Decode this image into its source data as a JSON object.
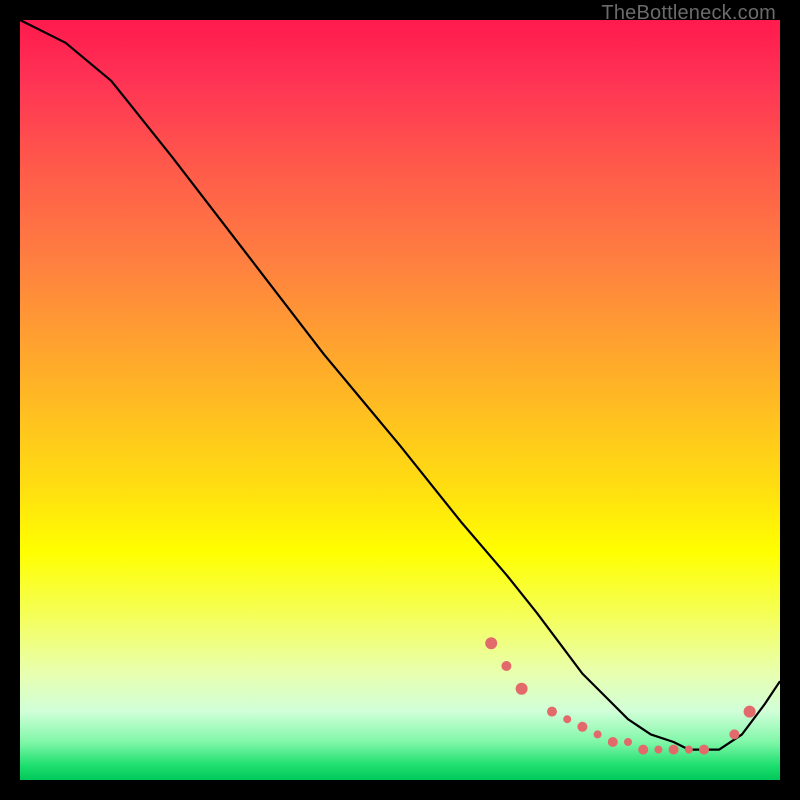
{
  "watermark": "TheBottleneck.com",
  "chart_data": {
    "type": "line",
    "title": "",
    "xlabel": "",
    "ylabel": "",
    "xlim": [
      0,
      100
    ],
    "ylim": [
      0,
      100
    ],
    "grid": false,
    "legend": false,
    "series": [
      {
        "name": "bottleneck-curve",
        "x": [
          0,
          6,
          12,
          20,
          30,
          40,
          50,
          58,
          64,
          68,
          71,
          74,
          77,
          80,
          83,
          86,
          88,
          90,
          92,
          95,
          98,
          100
        ],
        "y": [
          100,
          97,
          92,
          82,
          69,
          56,
          44,
          34,
          27,
          22,
          18,
          14,
          11,
          8,
          6,
          5,
          4,
          4,
          4,
          6,
          10,
          13
        ]
      }
    ],
    "markers": {
      "name": "sample-points",
      "x": [
        62,
        64,
        66,
        70,
        72,
        74,
        76,
        78,
        80,
        82,
        84,
        86,
        88,
        90,
        94,
        96
      ],
      "y": [
        18,
        15,
        12,
        9,
        8,
        7,
        6,
        5,
        5,
        4,
        4,
        4,
        4,
        4,
        6,
        9
      ],
      "r": [
        6,
        5,
        6,
        5,
        4,
        5,
        4,
        5,
        4,
        5,
        4,
        5,
        4,
        5,
        5,
        6
      ]
    },
    "background_gradient": {
      "stops": [
        {
          "pos": 0.0,
          "color": "#ff1a4d"
        },
        {
          "pos": 0.3,
          "color": "#ff8040"
        },
        {
          "pos": 0.55,
          "color": "#ffd018"
        },
        {
          "pos": 0.72,
          "color": "#ffff00"
        },
        {
          "pos": 0.9,
          "color": "#d0ffd8"
        },
        {
          "pos": 1.0,
          "color": "#00c85a"
        }
      ]
    }
  }
}
